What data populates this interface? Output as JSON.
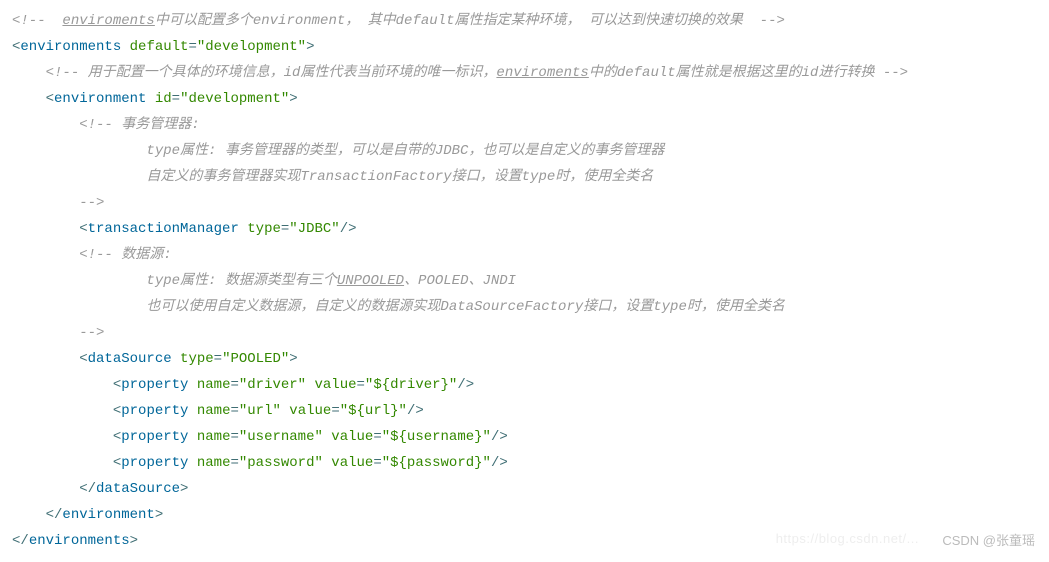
{
  "lines": {
    "c1a": "<!--  ",
    "c1b": "enviroments",
    "c1c": "中可以配置多个environment， 其中default属性指定某种环境， 可以达到快速切换的效果  -->",
    "l2_tag": "environments",
    "l2_attr": "default",
    "l2_val": "\"development\"",
    "c3a": "<!-- 用于配置一个具体的环境信息，id属性代表当前环境的唯一标识，",
    "c3b": "enviroments",
    "c3c": "中的default属性就是根据这里的id进行转换 -->",
    "l4_tag": "environment",
    "l4_attr": "id",
    "l4_val": "\"development\"",
    "c5": "<!-- 事务管理器:",
    "c6": "type属性: 事务管理器的类型，可以是自带的JDBC，也可以是自定义的事务管理器",
    "c7": "自定义的事务管理器实现TransactionFactory接口，设置type时，使用全类名",
    "c8": "-->",
    "l9_tag": "transactionManager",
    "l9_attr": "type",
    "l9_val": "\"JDBC\"",
    "c10": "<!-- 数据源:",
    "c11a": "type属性: 数据源类型有三个",
    "c11b": "UNPOOLED",
    "c11c": "、POOLED、JNDI",
    "c12": "也可以使用自定义数据源，自定义的数据源实现DataSourceFactory接口，设置type时，使用全类名",
    "c13": "-->",
    "l14_tag": "dataSource",
    "l14_attr": "type",
    "l14_val": "\"POOLED\"",
    "prop_tag": "property",
    "p1_na": "name",
    "p1_nv": "\"driver\"",
    "p1_va": "value",
    "p1_vv": "\"${driver}\"",
    "p2_na": "name",
    "p2_nv": "\"url\"",
    "p2_va": "value",
    "p2_vv": "\"${url}\"",
    "p3_na": "name",
    "p3_nv": "\"username\"",
    "p3_va": "value",
    "p3_vv": "\"${username}\"",
    "p4_na": "name",
    "p4_nv": "\"password\"",
    "p4_va": "value",
    "p4_vv": "\"${password}\"",
    "close_ds": "dataSource",
    "close_env": "environment",
    "close_envs": "environments",
    "watermark": "CSDN @张童瑶",
    "watermark2": "https://blog.csdn.net/..."
  }
}
